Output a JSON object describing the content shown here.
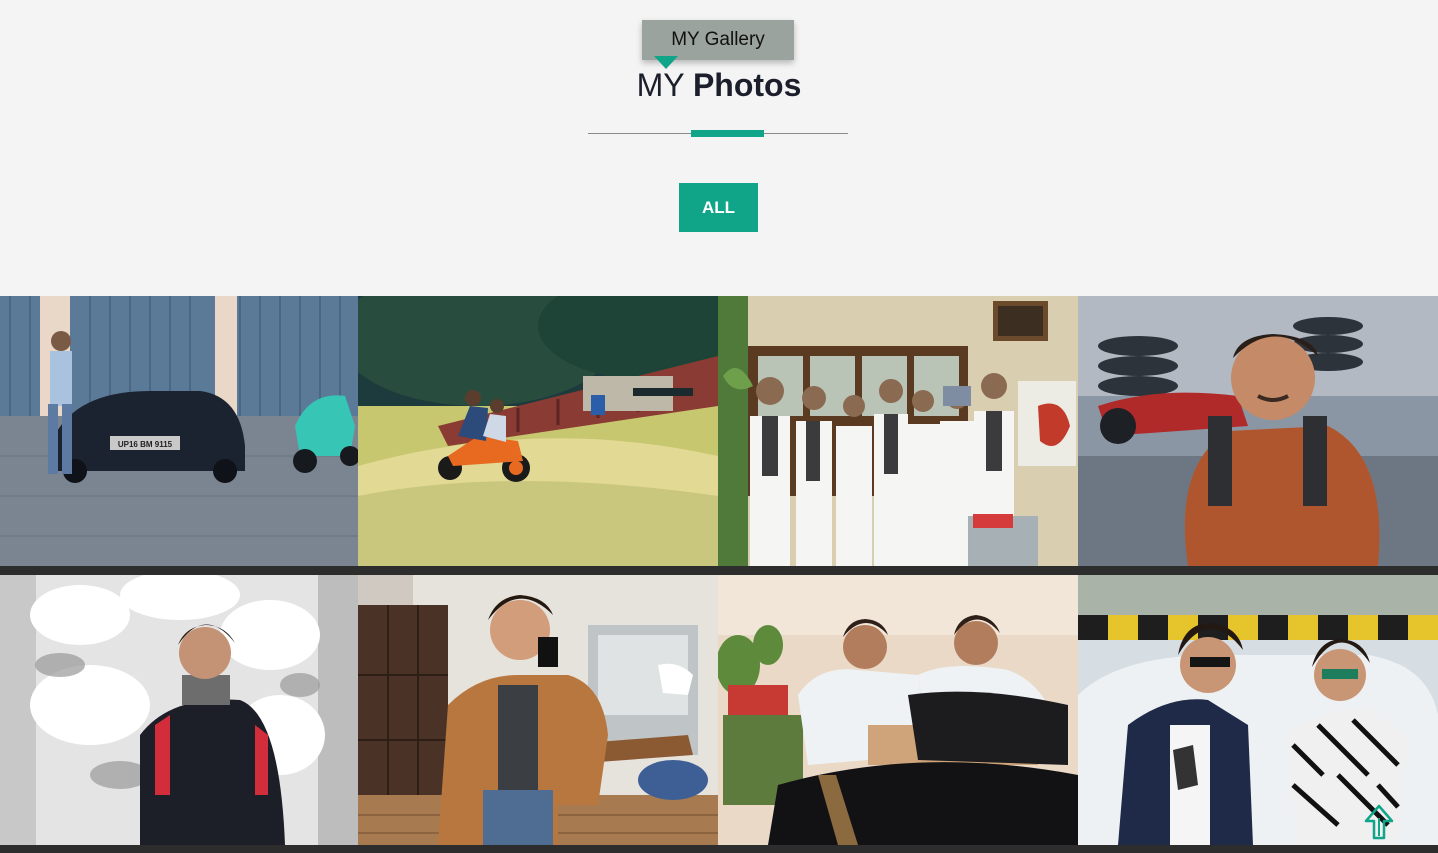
{
  "header": {
    "tag_label": "MY Gallery",
    "title_light": "MY",
    "title_bold": "Photos"
  },
  "filters": {
    "all_label": "ALL"
  },
  "colors": {
    "accent": "#10a489",
    "tag_background": "#9aa39d",
    "page_background": "#f4f4f4",
    "grid_background": "#2d2d2d"
  },
  "gallery": {
    "photos": [
      {
        "scene": "man leaning on a black sedan beside a green motorbike"
      },
      {
        "scene": "two riders on an orange motorbike on a sunny road"
      },
      {
        "scene": "group of students in white lab coats"
      },
      {
        "scene": "selfie in front of a red motorbike in a garage"
      },
      {
        "scene": "man in a black jacket against snowy trees"
      },
      {
        "scene": "mirror selfie in a brown leather jacket"
      },
      {
        "scene": "two men in white coats seated at a table"
      },
      {
        "scene": "two men in sunglasses by a white car"
      }
    ]
  },
  "scroll_top_icon": "up-arrow-icon"
}
